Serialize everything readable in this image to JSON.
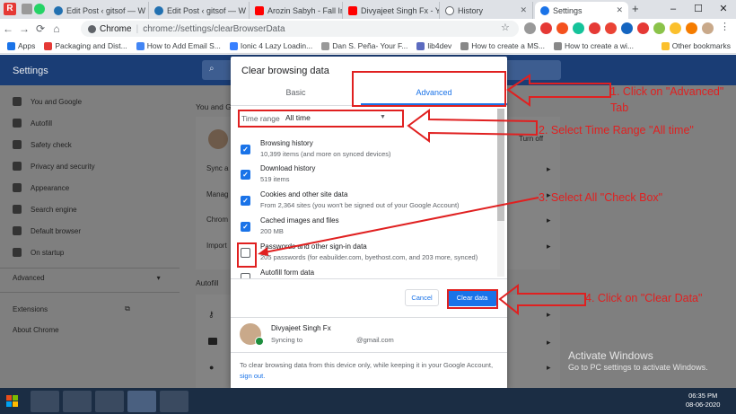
{
  "browser": {
    "tabs": [
      {
        "label": "Edit Post ‹ gitsof — W",
        "color": "#2271b1"
      },
      {
        "label": "Edit Post ‹ gitsof — W",
        "color": "#2271b1"
      },
      {
        "label": "Arozin Sabyh - Fall In",
        "color": "#ff0000"
      },
      {
        "label": "Divyajeet Singh Fx - Y",
        "color": "#ff0000"
      },
      {
        "label": "History",
        "color": "#5f6368"
      },
      {
        "label": "Settings",
        "color": "#1a73e8"
      }
    ],
    "address_prefix": "Chrome",
    "address_path": "chrome://settings/clearBrowserData",
    "bookmarks": [
      "Apps",
      "Packaging and Dist...",
      "How to Add Email S...",
      "Ionic 4 Lazy Loadin...",
      "Dan S. Peña- Your F...",
      "lib4dev",
      "How to create a MS...",
      "How to create a wi...",
      "Other bookmarks"
    ]
  },
  "settings": {
    "title": "Settings",
    "sidebar": [
      "You and Google",
      "Autofill",
      "Safety check",
      "Privacy and security",
      "Appearance",
      "Search engine",
      "Default browser",
      "On startup"
    ],
    "advanced": "Advanced",
    "extensions": "Extensions",
    "about": "About Chrome",
    "main_section1": "You and G",
    "row_sync": "Sync a",
    "row_manage": "Manag",
    "row_chrome": "Chrom",
    "row_import": "Import",
    "turn_off": "Turn off",
    "main_section2": "Autofill"
  },
  "dialog": {
    "title": "Clear browsing data",
    "tab_basic": "Basic",
    "tab_advanced": "Advanced",
    "time_range_label": "Time range",
    "time_range_value": "All time",
    "options": [
      {
        "title": "Browsing history",
        "sub": "10,399 items (and more on synced devices)",
        "checked": true
      },
      {
        "title": "Download history",
        "sub": "519 items",
        "checked": true
      },
      {
        "title": "Cookies and other site data",
        "sub": "From 2,364 sites (you won't be signed out of your Google Account)",
        "checked": true
      },
      {
        "title": "Cached images and files",
        "sub": "200 MB",
        "checked": true
      },
      {
        "title": "Passwords and other sign-in data",
        "sub": "205 passwords (for eabuilder.com, byethost.com, and 203 more, synced)",
        "checked": false
      },
      {
        "title": "Autofill form data",
        "sub": "",
        "checked": false
      }
    ],
    "cancel": "Cancel",
    "clear": "Clear data",
    "account_name": "Divyajeet Singh Fx",
    "account_sync": "Syncing to",
    "account_email": "@gmail.com",
    "footnote": "To clear browsing data from this device only, while keeping it in your Google Account,",
    "footnote_link": "sign out."
  },
  "annotations": {
    "step1": "1. Click on \"Advanced\" Tab",
    "step2": "2. Select Time Range \"All time\"",
    "step3": "3. Select All \"Check Box\"",
    "step4": "4. Click on \"Clear Data\""
  },
  "watermark": {
    "line1": "Activate Windows",
    "line2": "Go to PC settings to activate Windows."
  },
  "taskbar": {
    "time": "06:35 PM",
    "date": "08-06-2020"
  },
  "colors": {
    "accent": "#1a73e8",
    "annotation": "#e02020",
    "settings_header": "#1a3d75",
    "taskbar": "#1b2d44"
  }
}
